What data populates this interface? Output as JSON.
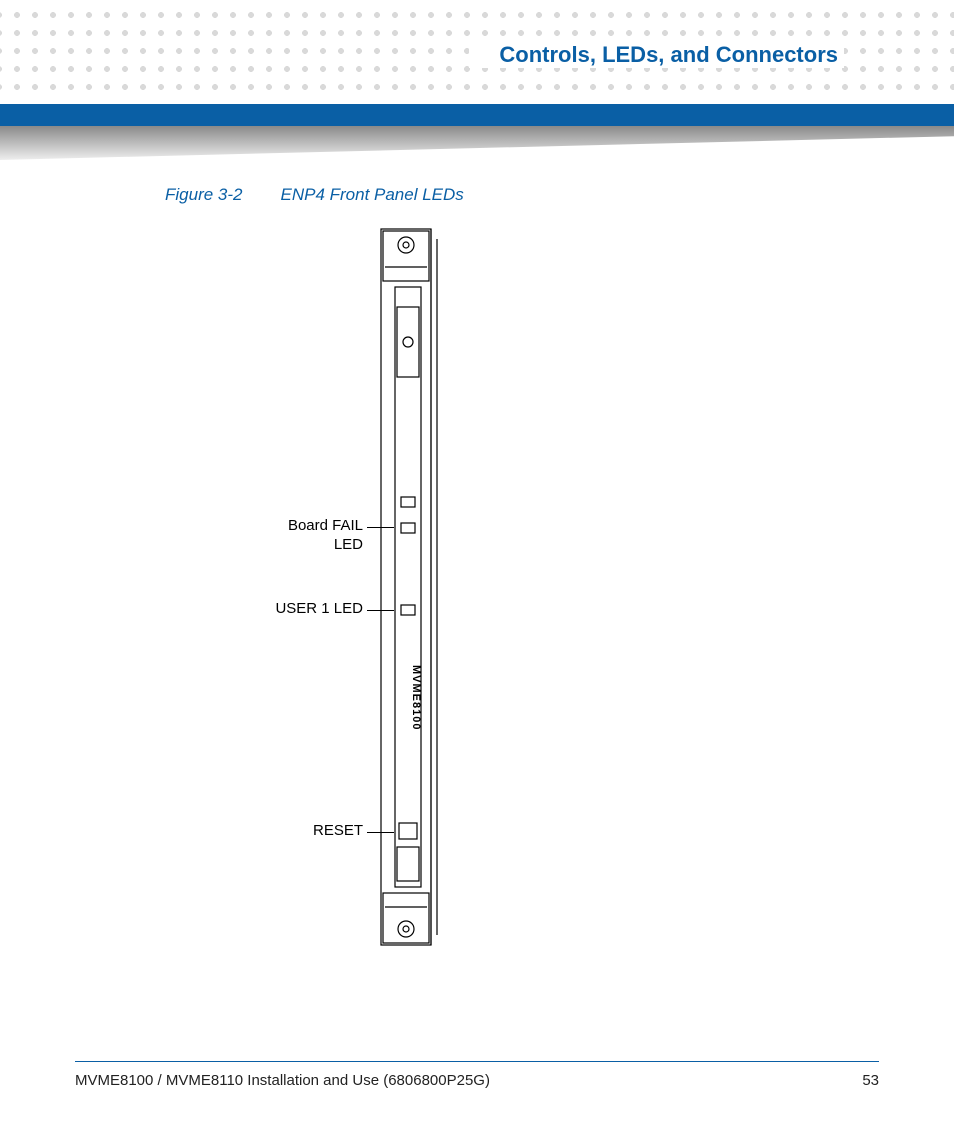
{
  "header": {
    "section_title": "Controls, LEDs, and Connectors"
  },
  "figure": {
    "ref": "Figure 3-2",
    "title": "ENP4 Front Panel LEDs",
    "board_label": "MVME8100",
    "callouts": {
      "board_fail": "Board FAIL LED",
      "user1": "USER 1 LED",
      "reset": "RESET"
    }
  },
  "footer": {
    "doc_line": "MVME8100 / MVME8110 Installation and Use (6806800P25G)",
    "page_number": "53"
  }
}
